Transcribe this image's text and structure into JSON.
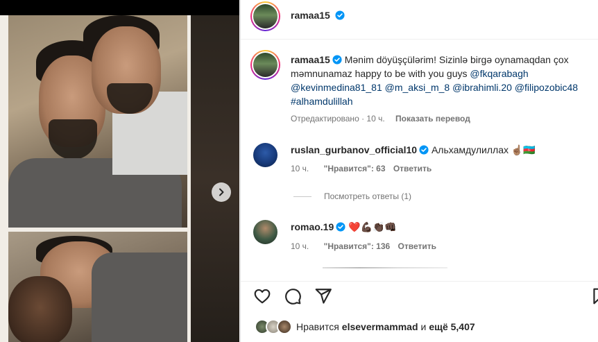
{
  "post": {
    "author": "ramaa15",
    "verified": true,
    "caption_prefix": "Mənim döyüşçülərim! Sizinlə birgə oynamaqdan çox məmnunamaz happy to be with you guys",
    "mentions": [
      "@fkqarabagh",
      "@kevinmedina81_81",
      "@m_aksi_m_8",
      "@ibrahimli.20",
      "@filipozobic48"
    ],
    "hashtag": "#alhamdulillah",
    "edited_label": "Отредактировано",
    "time": "10 ч.",
    "translate_label": "Показать перевод"
  },
  "comments": [
    {
      "user": "ruslan_gurbanov_official10",
      "verified": true,
      "text": "Альхамдулиллах",
      "emoji": "☝🏽🇦🇿",
      "time": "10 ч.",
      "likes_label": "\"Нравится\": 63",
      "reply_label": "Ответить",
      "view_replies": "Посмотреть ответы (1)"
    },
    {
      "user": "romao.19",
      "verified": true,
      "text": "",
      "emoji": "❤️💪🏿👏🏿👊🏿",
      "time": "10 ч.",
      "likes_label": "\"Нравится\": 136",
      "reply_label": "Ответить"
    }
  ],
  "likes": {
    "prefix": "Нравится",
    "user": "elsevermammad",
    "connector": "и",
    "others": "ещё 5,407"
  },
  "icons": [
    "heart-icon",
    "comment-icon",
    "share-icon",
    "bookmark-icon",
    "next-arrow-icon",
    "verified-icon"
  ],
  "colors": {
    "verified": "#0095f6",
    "link": "#00376b",
    "muted": "#737373"
  }
}
